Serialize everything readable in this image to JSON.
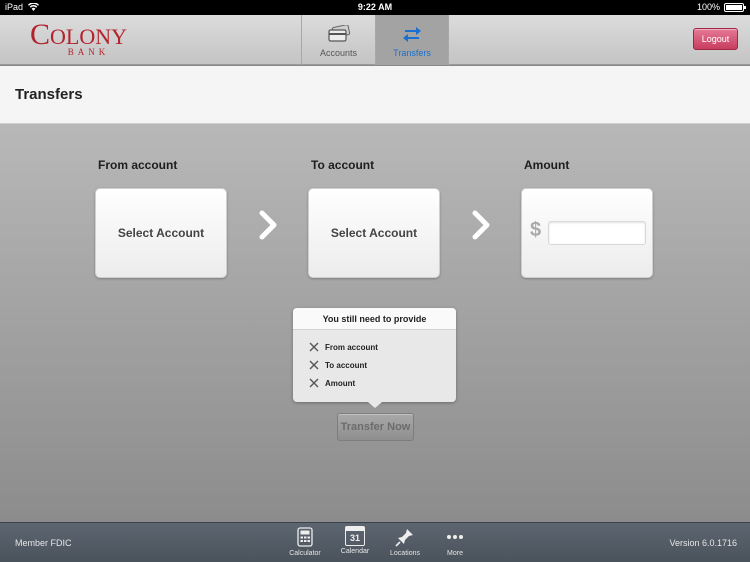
{
  "status_bar": {
    "device": "iPad",
    "time": "9:22 AM",
    "battery": "100%"
  },
  "header": {
    "logo": {
      "line1": "Colony",
      "line2": "BANK"
    },
    "tabs": [
      {
        "label": "Accounts",
        "icon": "accounts-card-icon",
        "active": false
      },
      {
        "label": "Transfers",
        "icon": "transfer-arrows-icon",
        "active": true
      }
    ],
    "logout_label": "Logout"
  },
  "page": {
    "title": "Transfers"
  },
  "transfer": {
    "from_label": "From account",
    "from_value": "Select Account",
    "to_label": "To account",
    "to_value": "Select Account",
    "amount_label": "Amount",
    "currency_symbol": "$",
    "amount_value": ""
  },
  "requirements": {
    "heading": "You still need to provide",
    "items": [
      "From account",
      "To account",
      "Amount"
    ]
  },
  "action": {
    "transfer_label": "Transfer Now"
  },
  "footer": {
    "left": "Member FDIC",
    "version": "Version 6.0.1716",
    "items": [
      {
        "label": "Calculator",
        "icon": "calculator-icon"
      },
      {
        "label": "Calendar",
        "icon": "calendar-icon",
        "day": "31"
      },
      {
        "label": "Locations",
        "icon": "location-pin-icon"
      },
      {
        "label": "More",
        "icon": "more-dots-icon"
      }
    ]
  },
  "colors": {
    "brand": "#b3232c",
    "active_tab": "#1a6fd0",
    "logout": "#d24f70"
  }
}
